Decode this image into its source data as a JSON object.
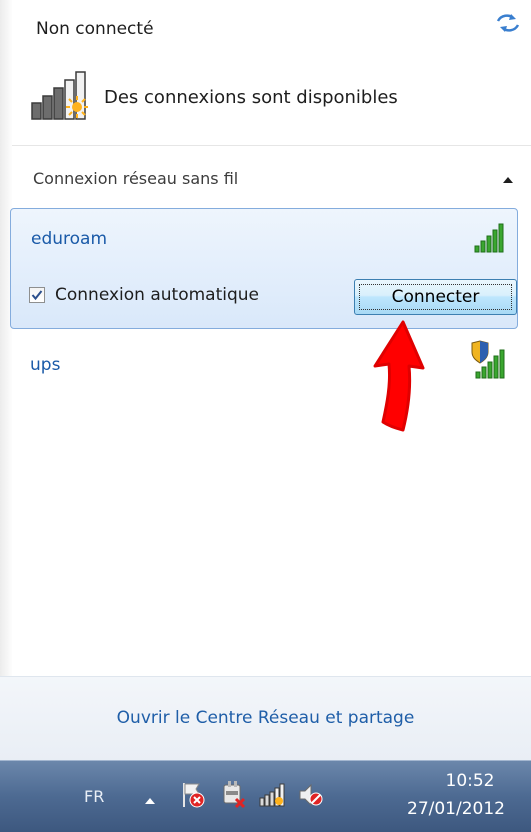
{
  "status": {
    "title": "Non connecté",
    "available_text": "Des connexions sont disponibles"
  },
  "section": {
    "title": "Connexion réseau sans fil"
  },
  "networks": [
    {
      "name": "eduroam",
      "selected": true,
      "secured": false
    },
    {
      "name": "ups",
      "selected": false,
      "secured": true
    }
  ],
  "selected_network": {
    "auto_connect_label": "Connexion automatique",
    "auto_connect_checked": true,
    "connect_label": "Connecter"
  },
  "footer": {
    "link_label": "Ouvrir le Centre Réseau et partage"
  },
  "taskbar": {
    "language": "FR",
    "time": "10:52",
    "date": "27/01/2012"
  },
  "colors": {
    "link": "#1f5ea8",
    "selection_border": "#84acdd",
    "annotation_arrow": "#ff0000",
    "signal_bars": "#3aa62f"
  },
  "icons": {
    "refresh": "refresh-icon",
    "availability": "network-available-icon",
    "collapse": "chevron-up-icon",
    "signal": "wifi-signal-icon",
    "secure": "shield-icon"
  }
}
